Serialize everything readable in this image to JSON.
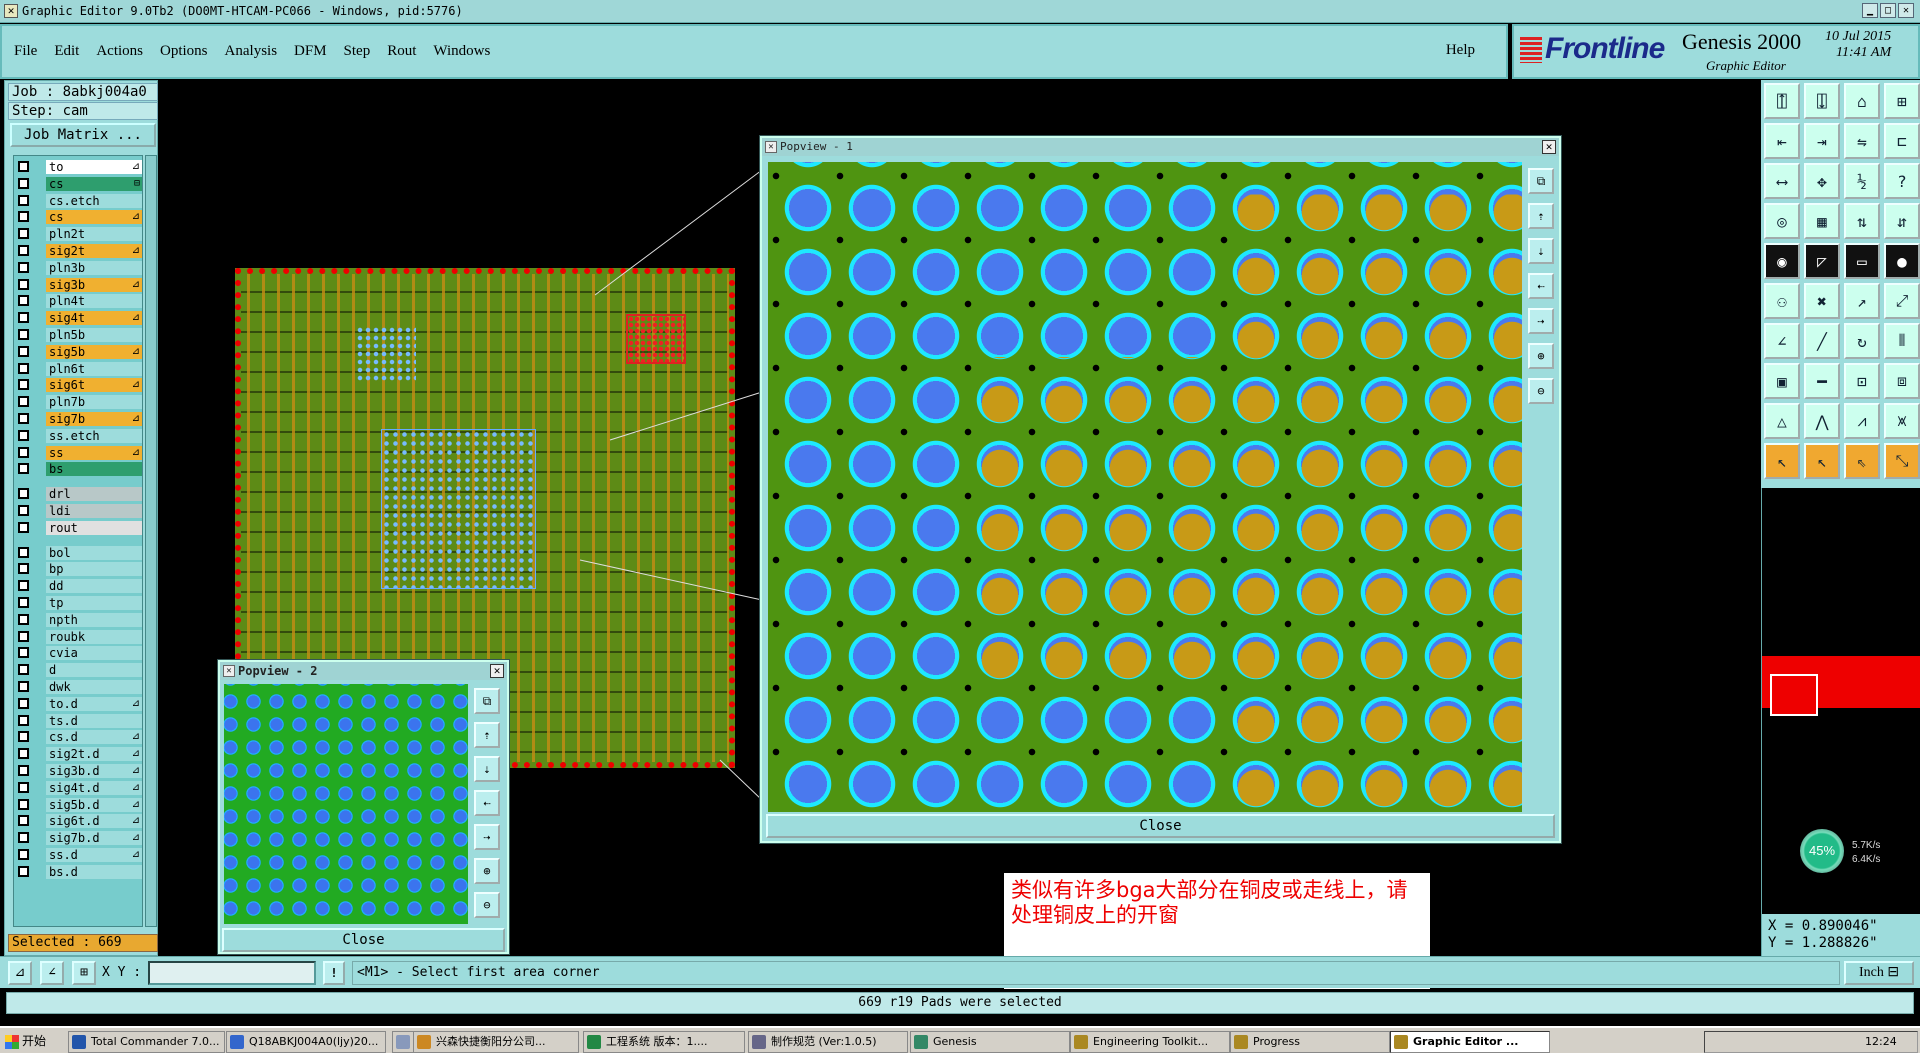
{
  "window": {
    "title": "Graphic Editor 9.0Tb2 (DO0MT-HTCAM-PC066 - Windows, pid:5776)"
  },
  "menu": {
    "items": [
      "File",
      "Edit",
      "Actions",
      "Options",
      "Analysis",
      "DFM",
      "Step",
      "Rout",
      "Windows"
    ],
    "help": "Help"
  },
  "brand": {
    "company": "Frontline",
    "product": "Genesis 2000",
    "subtitle": "Graphic Editor",
    "date": "10 Jul 2015",
    "time": "11:41 AM"
  },
  "job": {
    "job": "Job : 8abkj004a0",
    "step": "Step: cam",
    "job_matrix": "Job Matrix ..."
  },
  "layers": [
    {
      "name": "to",
      "color": "#ffffff",
      "flag": "⊿"
    },
    {
      "name": "cs",
      "color": "#2e9e6e",
      "flag": "⊟"
    },
    {
      "name": "cs.etch",
      "color": "#9ddcdc",
      "flag": ""
    },
    {
      "name": "cs",
      "color": "#f0b030",
      "flag": "⊿"
    },
    {
      "name": "pln2t",
      "color": "#9ddcdc",
      "flag": ""
    },
    {
      "name": "sig2t",
      "color": "#f0b030",
      "flag": "⊿"
    },
    {
      "name": "pln3b",
      "color": "#9ddcdc",
      "flag": ""
    },
    {
      "name": "sig3b",
      "color": "#f0b030",
      "flag": "⊿"
    },
    {
      "name": "pln4t",
      "color": "#9ddcdc",
      "flag": ""
    },
    {
      "name": "sig4t",
      "color": "#f0b030",
      "flag": "⊿"
    },
    {
      "name": "pln5b",
      "color": "#9ddcdc",
      "flag": ""
    },
    {
      "name": "sig5b",
      "color": "#f0b030",
      "flag": "⊿"
    },
    {
      "name": "pln6t",
      "color": "#9ddcdc",
      "flag": ""
    },
    {
      "name": "sig6t",
      "color": "#f0b030",
      "flag": "⊿"
    },
    {
      "name": "pln7b",
      "color": "#9ddcdc",
      "flag": ""
    },
    {
      "name": "sig7b",
      "color": "#f0b030",
      "flag": "⊿"
    },
    {
      "name": "ss.etch",
      "color": "#9ddcdc",
      "flag": ""
    },
    {
      "name": "ss",
      "color": "#f0b030",
      "flag": "⊿"
    },
    {
      "name": "bs",
      "color": "#2e9e6e",
      "flag": ""
    },
    {
      "name": "drl",
      "color": "#b8c8c8",
      "flag": ""
    },
    {
      "name": "ldi",
      "color": "#b8c8c8",
      "flag": ""
    },
    {
      "name": "rout",
      "color": "#e0e0e0",
      "flag": ""
    },
    {
      "name": "bol",
      "color": "#9ddcdc",
      "flag": ""
    },
    {
      "name": "bp",
      "color": "#9ddcdc",
      "flag": ""
    },
    {
      "name": "dd",
      "color": "#9ddcdc",
      "flag": ""
    },
    {
      "name": "tp",
      "color": "#9ddcdc",
      "flag": ""
    },
    {
      "name": "npth",
      "color": "#9ddcdc",
      "flag": ""
    },
    {
      "name": "roubk",
      "color": "#9ddcdc",
      "flag": ""
    },
    {
      "name": "cvia",
      "color": "#9ddcdc",
      "flag": ""
    },
    {
      "name": "d",
      "color": "#9ddcdc",
      "flag": ""
    },
    {
      "name": "dwk",
      "color": "#9ddcdc",
      "flag": ""
    },
    {
      "name": "to.d",
      "color": "#9ddcdc",
      "flag": "⊿"
    },
    {
      "name": "ts.d",
      "color": "#9ddcdc",
      "flag": ""
    },
    {
      "name": "cs.d",
      "color": "#9ddcdc",
      "flag": "⊿"
    },
    {
      "name": "sig2t.d",
      "color": "#9ddcdc",
      "flag": "⊿"
    },
    {
      "name": "sig3b.d",
      "color": "#9ddcdc",
      "flag": "⊿"
    },
    {
      "name": "sig4t.d",
      "color": "#9ddcdc",
      "flag": "⊿"
    },
    {
      "name": "sig5b.d",
      "color": "#9ddcdc",
      "flag": "⊿"
    },
    {
      "name": "sig6t.d",
      "color": "#9ddcdc",
      "flag": "⊿"
    },
    {
      "name": "sig7b.d",
      "color": "#9ddcdc",
      "flag": "⊿"
    },
    {
      "name": "ss.d",
      "color": "#9ddcdc",
      "flag": "⊿"
    },
    {
      "name": "bs.d",
      "color": "#9ddcdc",
      "flag": ""
    }
  ],
  "selected": "Selected : 669",
  "popview1": {
    "title": "Popview - 1",
    "close": "Close"
  },
  "popview2": {
    "title": "Popview - 2",
    "close": "Close"
  },
  "note": "类似有许多bga大部分在铜皮或走线上，请处理铜皮上的开窗",
  "readout": {
    "x": "X = 0.890046\"",
    "y": "Y = 1.288826\""
  },
  "meter": {
    "percent": "45%",
    "up": "5.7K/s",
    "down": "6.4K/s"
  },
  "command": {
    "xy_label": "X Y :",
    "xy_value": "",
    "prompt": "<M1> - Select first area corner",
    "unit": "Inch ⊟"
  },
  "status": "669 r19 Pads were selected",
  "taskbar": {
    "start": "开始",
    "tasks": [
      {
        "label": "Total Commander 7.0...",
        "color": "#2255aa"
      },
      {
        "label": "Q18ABKJ004A0(ljy)20...",
        "color": "#3366cc"
      },
      {
        "label": "",
        "color": "#8899bb"
      },
      {
        "label": "兴森快捷衡阳分公司...",
        "color": "#cc8822"
      },
      {
        "label": "工程系统    版本：1....",
        "color": "#228844"
      },
      {
        "label": "制作规范 (Ver:1.0.5)",
        "color": "#666688"
      },
      {
        "label": "Genesis",
        "color": "#338866"
      },
      {
        "label": "Engineering Toolkit...",
        "color": "#aa8822"
      },
      {
        "label": "Progress",
        "color": "#aa8822"
      },
      {
        "label": "Graphic Editor ...",
        "color": "#aa8822"
      }
    ],
    "clock": "12:24"
  }
}
